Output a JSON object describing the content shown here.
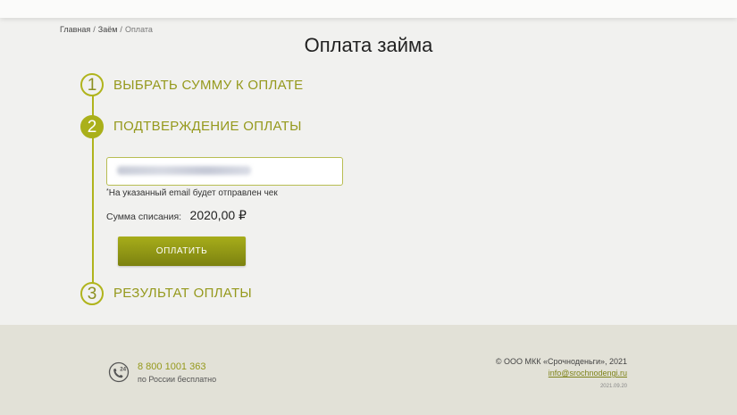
{
  "breadcrumb": {
    "items": [
      "Главная",
      "Заём"
    ],
    "current": "Оплата",
    "separator": "/"
  },
  "page": {
    "title": "Оплата займа"
  },
  "steps": [
    {
      "number": "1",
      "title": "ВЫБРАТЬ СУММУ К ОПЛАТЕ",
      "state": "done"
    },
    {
      "number": "2",
      "title": "ПОДТВЕРЖДЕНИЕ ОПЛАТЫ",
      "state": "active"
    },
    {
      "number": "3",
      "title": "РЕЗУЛЬТАТ ОПЛАТЫ",
      "state": "pending"
    }
  ],
  "form": {
    "email_note_star": "*",
    "email_note": "На указанный email будет отправлен чек",
    "sum_label": "Сумма списания:",
    "sum_value": "2020,00 ₽",
    "pay_button": "ОПЛАТИТЬ"
  },
  "footer": {
    "phone": "8 800 1001 363",
    "phone_note": "по России бесплатно",
    "phone_icon": "phone-24-icon",
    "copyright": "© ООО МКК «Срочноденьги», 2021",
    "email": "info@srochnodengi.ru",
    "version": "2021.09.20"
  },
  "colors": {
    "accent": "#aab01a",
    "accent_text": "#95991c",
    "footer_bg": "#e2e1d7",
    "page_bg": "#f1f1ef"
  }
}
